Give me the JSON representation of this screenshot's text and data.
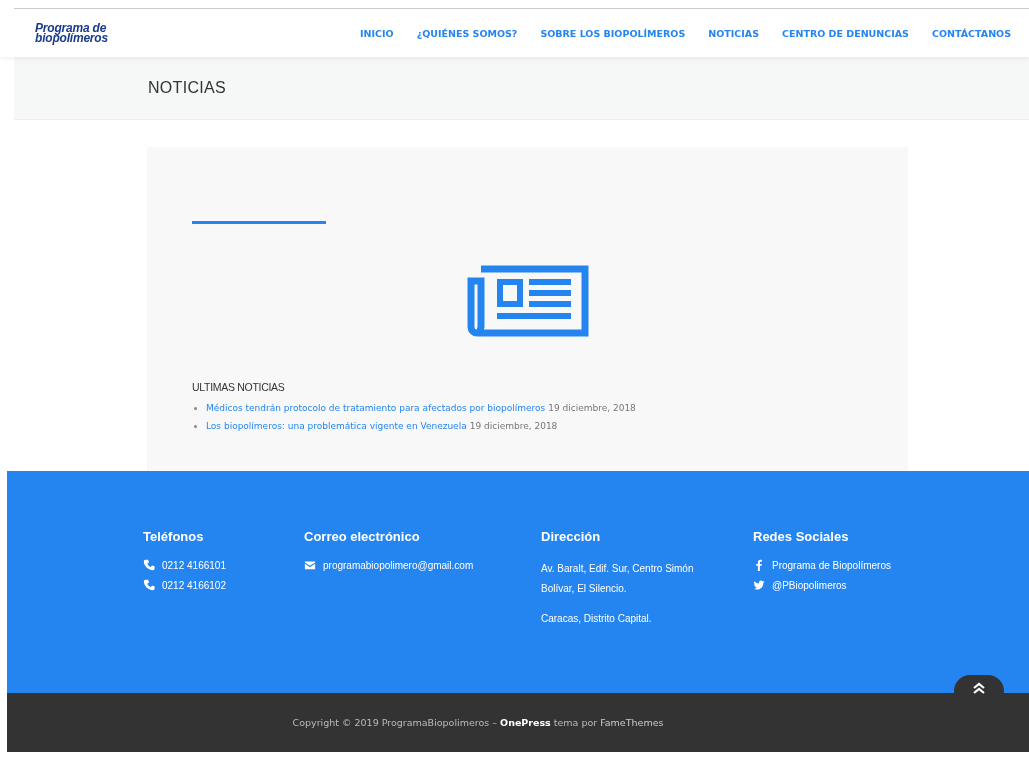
{
  "header": {
    "logo": [
      "Programa de",
      "biopolímeros"
    ],
    "nav": [
      "INICIO",
      "¿QUIÉNES SOMOS?",
      "SOBRE LOS BIOPOLÍMEROS",
      "NOTICIAS",
      "CENTRO DE DENUNCIAS",
      "CONTÁCTANOS"
    ]
  },
  "page_title": "NOTICIAS",
  "news": {
    "heading": "ULTIMAS NOTICIAS",
    "items": [
      {
        "title": "Médicos tendrán protocolo de tratamiento para afectados por biopolímeros",
        "date": "19 diciembre, 2018"
      },
      {
        "title": "Los biopolímeros: una problemática vigente en Venezuela",
        "date": "19 diciembre, 2018"
      }
    ]
  },
  "footer": {
    "columns": [
      {
        "title": "Teléfonos",
        "kind": "list",
        "items": [
          {
            "kind": "phone",
            "text": "0212 4166101"
          },
          {
            "kind": "phone",
            "text": "0212 4166102"
          }
        ]
      },
      {
        "title": "Correo electrónico",
        "kind": "list",
        "items": [
          {
            "kind": "mail",
            "text": "programabiopolimero@gmail.com"
          }
        ]
      },
      {
        "title": "Dirección",
        "kind": "text",
        "paragraphs": [
          "Av. Baralt, Edif. Sur, Centro Simón Bolívar, El Silencio.",
          "Caracas, Distrito Capital."
        ]
      },
      {
        "title": "Redes Sociales",
        "kind": "list",
        "items": [
          {
            "kind": "facebook",
            "text": "Programa de Biopolímeros"
          },
          {
            "kind": "twitter",
            "text": "@PBiopolimeros"
          }
        ]
      }
    ]
  },
  "copyright": {
    "before": "Copyright © 2019 ProgramaBiopolimeros – ",
    "theme": "OnePress",
    "middle": " tema por ",
    "author": "FameThemes"
  }
}
